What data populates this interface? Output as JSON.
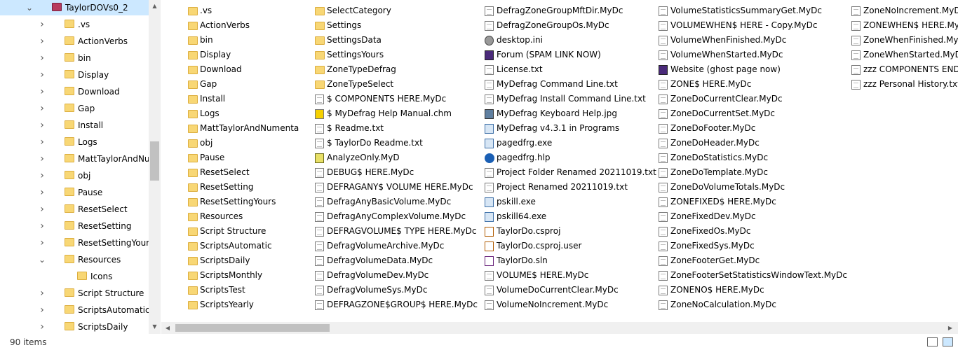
{
  "nav": {
    "items": [
      {
        "label": "TaylorDOVs0_2",
        "expanded": true,
        "selected": true,
        "level": 0
      },
      {
        "label": ".vs",
        "level": 1
      },
      {
        "label": "ActionVerbs",
        "level": 1
      },
      {
        "label": "bin",
        "level": 1
      },
      {
        "label": "Display",
        "level": 1
      },
      {
        "label": "Download",
        "level": 1
      },
      {
        "label": "Gap",
        "level": 1
      },
      {
        "label": "Install",
        "level": 1
      },
      {
        "label": "Logs",
        "level": 1
      },
      {
        "label": "MattTaylorAndNumenta",
        "level": 1
      },
      {
        "label": "obj",
        "level": 1
      },
      {
        "label": "Pause",
        "level": 1
      },
      {
        "label": "ResetSelect",
        "level": 1
      },
      {
        "label": "ResetSetting",
        "level": 1
      },
      {
        "label": "ResetSettingYours",
        "level": 1
      },
      {
        "label": "Resources",
        "expanded": true,
        "level": 1
      },
      {
        "label": "Icons",
        "level": 2
      },
      {
        "label": "Script Structure",
        "level": 1
      },
      {
        "label": "ScriptsAutomatic",
        "level": 1
      },
      {
        "label": "ScriptsDaily",
        "level": 1
      }
    ]
  },
  "files": {
    "columns": [
      [
        {
          "name": ".vs",
          "icon": "folder-icon"
        },
        {
          "name": "ActionVerbs",
          "icon": "folder-icon"
        },
        {
          "name": "bin",
          "icon": "folder-icon"
        },
        {
          "name": "Display",
          "icon": "folder-icon"
        },
        {
          "name": "Download",
          "icon": "folder-icon"
        },
        {
          "name": "Gap",
          "icon": "folder-icon"
        },
        {
          "name": "Install",
          "icon": "folder-icon"
        },
        {
          "name": "Logs",
          "icon": "folder-icon"
        },
        {
          "name": "MattTaylorAndNumenta",
          "icon": "folder-icon"
        },
        {
          "name": "obj",
          "icon": "folder-icon"
        },
        {
          "name": "Pause",
          "icon": "folder-icon"
        },
        {
          "name": "ResetSelect",
          "icon": "folder-icon"
        },
        {
          "name": "ResetSetting",
          "icon": "folder-icon"
        },
        {
          "name": "ResetSettingYours",
          "icon": "folder-icon"
        },
        {
          "name": "Resources",
          "icon": "folder-icon"
        },
        {
          "name": "Script Structure",
          "icon": "folder-icon"
        },
        {
          "name": "ScriptsAutomatic",
          "icon": "folder-icon"
        },
        {
          "name": "ScriptsDaily",
          "icon": "folder-icon"
        },
        {
          "name": "ScriptsMonthly",
          "icon": "folder-icon"
        },
        {
          "name": "ScriptsTest",
          "icon": "folder-icon"
        },
        {
          "name": "ScriptsYearly",
          "icon": "folder-icon"
        }
      ],
      [
        {
          "name": "SelectCategory",
          "icon": "folder-icon"
        },
        {
          "name": "Settings",
          "icon": "folder-icon"
        },
        {
          "name": "SettingsData",
          "icon": "folder-icon"
        },
        {
          "name": "SettingsYours",
          "icon": "folder-icon"
        },
        {
          "name": "ZoneTypeDefrag",
          "icon": "folder-icon"
        },
        {
          "name": "ZoneTypeSelect",
          "icon": "folder-icon"
        },
        {
          "name": "$ COMPONENTS HERE.MyDc",
          "icon": "document-icon"
        },
        {
          "name": "$ MyDefrag Help Manual.chm",
          "icon": "chm-help-icon"
        },
        {
          "name": "$ Readme.txt",
          "icon": "text-file-icon"
        },
        {
          "name": "$ TaylorDo Readme.txt",
          "icon": "text-file-icon"
        },
        {
          "name": "AnalyzeOnly.MyD",
          "icon": "mydefrag-script-icon"
        },
        {
          "name": "DEBUG$ HERE.MyDc",
          "icon": "document-icon"
        },
        {
          "name": "DEFRAGANY$ VOLUME HERE.MyDc",
          "icon": "document-icon"
        },
        {
          "name": "DefragAnyBasicVolume.MyDc",
          "icon": "document-icon"
        },
        {
          "name": "DefragAnyComplexVolume.MyDc",
          "icon": "document-icon"
        },
        {
          "name": "DEFRAGVOLUME$ TYPE HERE.MyDc",
          "icon": "document-icon"
        },
        {
          "name": "DefragVolumeArchive.MyDc",
          "icon": "document-icon"
        },
        {
          "name": "DefragVolumeData.MyDc",
          "icon": "document-icon"
        },
        {
          "name": "DefragVolumeDev.MyDc",
          "icon": "document-icon"
        },
        {
          "name": "DefragVolumeSys.MyDc",
          "icon": "document-icon"
        },
        {
          "name": "DEFRAGZONE$GROUP$ HERE.MyDc",
          "icon": "document-icon"
        }
      ],
      [
        {
          "name": "DefragZoneGroupMftDir.MyDc",
          "icon": "document-icon"
        },
        {
          "name": "DefragZoneGroupOs.MyDc",
          "icon": "document-icon"
        },
        {
          "name": "desktop.ini",
          "icon": "settings-file-icon"
        },
        {
          "name": "Forum (SPAM LINK NOW)",
          "icon": "internet-shortcut-icon"
        },
        {
          "name": "License.txt",
          "icon": "text-file-icon"
        },
        {
          "name": "MyDefrag Command Line.txt",
          "icon": "text-file-icon"
        },
        {
          "name": "MyDefrag Install Command Line.txt",
          "icon": "text-file-icon"
        },
        {
          "name": "MyDefrag Keyboard Help.jpg",
          "icon": "image-file-icon"
        },
        {
          "name": "MyDefrag v4.3.1 in Programs",
          "icon": "shortcut-icon"
        },
        {
          "name": "pagedfrg.exe",
          "icon": "executable-icon"
        },
        {
          "name": "pagedfrg.hlp",
          "icon": "help-file-icon"
        },
        {
          "name": "Project Folder Renamed 20211019.txt",
          "icon": "text-file-icon"
        },
        {
          "name": "Project Renamed 20211019.txt",
          "icon": "text-file-icon"
        },
        {
          "name": "pskill.exe",
          "icon": "executable-icon"
        },
        {
          "name": "pskill64.exe",
          "icon": "executable-icon"
        },
        {
          "name": "TaylorDo.csproj",
          "icon": "csproj-icon"
        },
        {
          "name": "TaylorDo.csproj.user",
          "icon": "csproj-user-icon"
        },
        {
          "name": "TaylorDo.sln",
          "icon": "visual-studio-solution-icon"
        },
        {
          "name": "VOLUME$ HERE.MyDc",
          "icon": "document-icon"
        },
        {
          "name": "VolumeDoCurrentClear.MyDc",
          "icon": "document-icon"
        },
        {
          "name": "VolumeNoIncrement.MyDc",
          "icon": "document-icon"
        }
      ],
      [
        {
          "name": "VolumeStatisticsSummaryGet.MyDc",
          "icon": "document-icon"
        },
        {
          "name": "VOLUMEWHEN$ HERE - Copy.MyDc",
          "icon": "document-icon"
        },
        {
          "name": "VolumeWhenFinished.MyDc",
          "icon": "document-icon"
        },
        {
          "name": "VolumeWhenStarted.MyDc",
          "icon": "document-icon"
        },
        {
          "name": "Website (ghost page now)",
          "icon": "internet-shortcut-icon"
        },
        {
          "name": "ZONE$ HERE.MyDc",
          "icon": "document-icon"
        },
        {
          "name": "ZoneDoCurrentClear.MyDc",
          "icon": "document-icon"
        },
        {
          "name": "ZoneDoCurrentSet.MyDc",
          "icon": "document-icon"
        },
        {
          "name": "ZoneDoFooter.MyDc",
          "icon": "document-icon"
        },
        {
          "name": "ZoneDoHeader.MyDc",
          "icon": "document-icon"
        },
        {
          "name": "ZoneDoStatistics.MyDc",
          "icon": "document-icon"
        },
        {
          "name": "ZoneDoTemplate.MyDc",
          "icon": "document-icon"
        },
        {
          "name": "ZoneDoVolumeTotals.MyDc",
          "icon": "document-icon"
        },
        {
          "name": "ZONEFIXED$ HERE.MyDc",
          "icon": "document-icon"
        },
        {
          "name": "ZoneFixedDev.MyDc",
          "icon": "document-icon"
        },
        {
          "name": "ZoneFixedOs.MyDc",
          "icon": "document-icon"
        },
        {
          "name": "ZoneFixedSys.MyDc",
          "icon": "document-icon"
        },
        {
          "name": "ZoneFooterGet.MyDc",
          "icon": "document-icon"
        },
        {
          "name": "ZoneFooterSetStatisticsWindowText.MyDc",
          "icon": "document-icon"
        },
        {
          "name": "ZONENO$ HERE.MyDc",
          "icon": "document-icon"
        },
        {
          "name": "ZoneNoCalculation.MyDc",
          "icon": "document-icon"
        }
      ],
      [
        {
          "name": "ZoneNoIncrement.MyDc",
          "icon": "document-icon"
        },
        {
          "name": "ZONEWHEN$ HERE.MyDc",
          "icon": "document-icon"
        },
        {
          "name": "ZoneWhenFinished.MyDc",
          "icon": "document-icon"
        },
        {
          "name": "ZoneWhenStarted.MyDc",
          "icon": "document-icon"
        },
        {
          "name": "zzz COMPONENTS END.MyDc",
          "icon": "text-file-icon"
        },
        {
          "name": "zzz Personal History.txt",
          "icon": "text-file-icon"
        }
      ]
    ]
  },
  "status": {
    "item_count": "90 items"
  },
  "colors": {
    "selection": "#cce8ff",
    "folder": "#f8d775",
    "scrollbar_thumb": "#c1c1c1"
  }
}
